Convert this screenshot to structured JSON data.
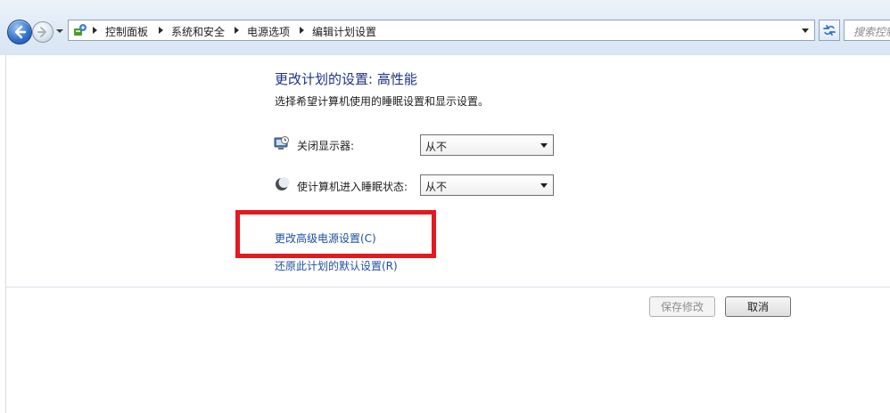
{
  "addressbar": {
    "breadcrumbs": [
      "控制面板",
      "系统和安全",
      "电源选项",
      "编辑计划设置"
    ],
    "search_placeholder": "搜索控制面板"
  },
  "main": {
    "heading": "更改计划的设置: 高性能",
    "subtext": "选择希望计算机使用的睡眠设置和显示设置。",
    "settings": [
      {
        "label": "关闭显示器:",
        "value": "从不",
        "icon": "monitor-clock-icon"
      },
      {
        "label": "使计算机进入睡眠状态:",
        "value": "从不",
        "icon": "moon-icon"
      }
    ],
    "links": {
      "advanced": "更改高级电源设置(C)",
      "restore": "还原此计划的默认设置(R)"
    },
    "buttons": {
      "save": "保存修改",
      "cancel": "取消"
    }
  },
  "colors": {
    "heading": "#1e3287",
    "link": "#1e50a0",
    "highlight": "#e4191d"
  }
}
